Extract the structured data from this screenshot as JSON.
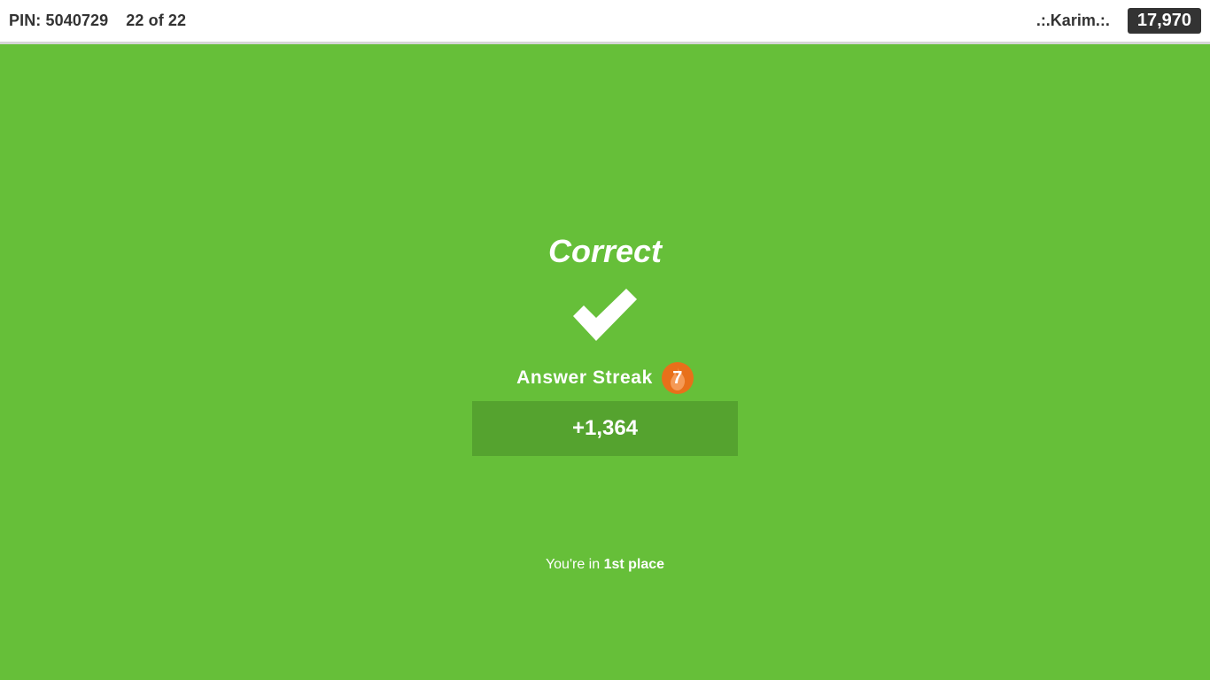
{
  "header": {
    "pin": "PIN: 5040729",
    "question_progress": "22 of 22",
    "nickname": ".:.Karim.:.",
    "total_score": "17,970"
  },
  "result": {
    "title": "Correct",
    "icon": "checkmark-icon",
    "streak_label": "Answer Streak",
    "streak_count": "7",
    "points_gained": "+1,364",
    "place_prefix": "You're in ",
    "place_value": "1st place"
  },
  "colors": {
    "background": "#66bf39",
    "points_box": "#55a32f",
    "streak_badge": "#e8701a",
    "score_box": "#333333"
  }
}
